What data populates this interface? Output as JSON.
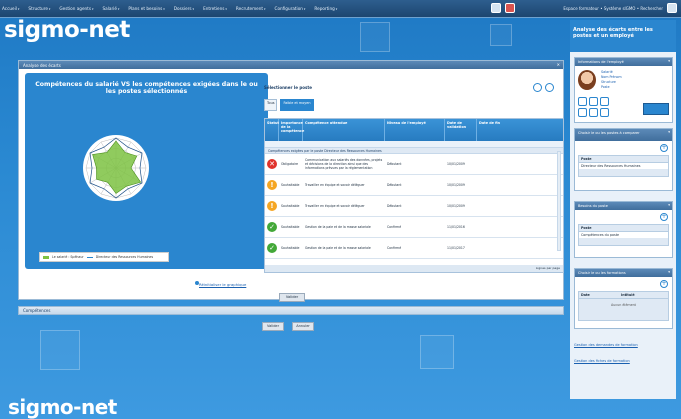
{
  "topmenu": {
    "items": [
      "Accueil",
      "Structure",
      "Gestion agents",
      "Salarié",
      "Plans et besoins",
      "Dossiers",
      "Entretiens",
      "Recrutement",
      "Configuration",
      "Reporting"
    ],
    "right_text": "Espace formateur • Système sIGMO • Rechercher"
  },
  "brand": {
    "logo": "sigmo-net"
  },
  "sidebar_top": {
    "line1": "Analyse des écarts entre les",
    "line2": "postes et un employé"
  },
  "main_panel": {
    "header": "Analyse des écarts",
    "radar_title": "Compétences du salarié VS les compétences exigées dans le ou les postes sélectionnés",
    "legend": {
      "employee": "Le salarié : Spéhaur",
      "positions": "Directeur des Ressources Humaines"
    },
    "radar_link": "Réinitialiser le graphique",
    "selector_title": "Sélectionner le poste",
    "chips": [
      "Tous",
      "Faible et moyen"
    ],
    "table_headers": [
      "Statut",
      "Importance de la compétence",
      "Compétence attendue",
      "Niveau de l'employé",
      "Date de validation",
      "Date de fin"
    ],
    "group_row": "Compétences exigées par le poste Directeur des Ressources Humaines",
    "rows": [
      {
        "status": "x",
        "importance": "Obligatoire",
        "text": "Communication aux salariés des données, projets et décisions de la direction ainsi que des informations prévues par la réglementation",
        "level": "Débutant",
        "date": "10/01/2009"
      },
      {
        "status": "!",
        "importance": "Souhaitable",
        "text": "Travailler en équipe et savoir déléguer",
        "level": "Débutant",
        "date": "10/01/2009"
      },
      {
        "status": "!",
        "importance": "Souhaitable",
        "text": "Travailler en équipe et savoir déléguer",
        "level": "Débutant",
        "date": "10/01/2009"
      },
      {
        "status": "ok",
        "importance": "Souhaitable",
        "text": "Gestion de la paie et de la masse salariale",
        "level": "Confirmé",
        "date": "11/01/2016"
      },
      {
        "status": "ok",
        "importance": "Souhaitable",
        "text": "Gestion de la paie et de la masse salariale",
        "level": "Confirmé",
        "date": "11/01/2017"
      }
    ],
    "table_footer": "Lignes par page",
    "validate_button": "Valider"
  },
  "competences_bar": "Compétences",
  "bottom_buttons": [
    "Valider",
    "Annuler"
  ],
  "sidebar": {
    "employee_header": "Informations de l'employé",
    "employee_name": "Salarié",
    "employee_info": [
      "Nom Prénom",
      "Structure",
      "Poste"
    ],
    "posts_header": "Choisir le ou les postes à comparer",
    "posts_sub": "Poste",
    "posts_item": "Directeur des Ressources Humaines",
    "besoins_header": "Besoins du poste",
    "besoins_sub": "Poste",
    "besoins_item": "Compétences du poste",
    "form_header": "Choisir le ou les formations",
    "form_cols": [
      "Date",
      "Intitulé"
    ],
    "form_item": "Aucun élément",
    "link1": "Gestion des demandes de formation",
    "link2": "Gestion des fiches de formation"
  }
}
